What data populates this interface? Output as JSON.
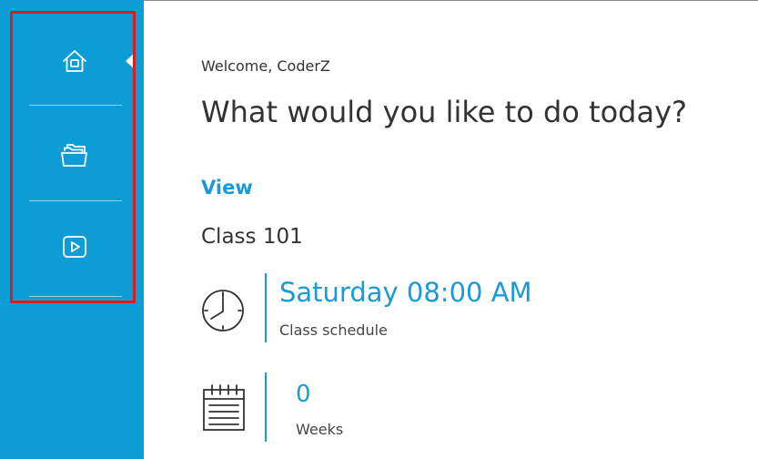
{
  "sidebar": {
    "items": [
      {
        "name": "home",
        "icon": "home-icon",
        "active": true
      },
      {
        "name": "folders",
        "icon": "folders-icon",
        "active": false
      },
      {
        "name": "video",
        "icon": "play-video-icon",
        "active": false
      }
    ],
    "background_color": "#0c9cd6",
    "highlight_color": "#e0191f"
  },
  "main": {
    "welcome": "Welcome, CoderZ",
    "headline": "What would you like to do today?",
    "view_link": "View",
    "class_name": "Class 101",
    "schedule": {
      "value": "Saturday 08:00 AM",
      "label": "Class schedule",
      "icon": "clock-icon"
    },
    "weeks": {
      "value": "0",
      "label": "Weeks",
      "icon": "calendar-icon"
    },
    "accent_color": "#1a9ad6"
  }
}
